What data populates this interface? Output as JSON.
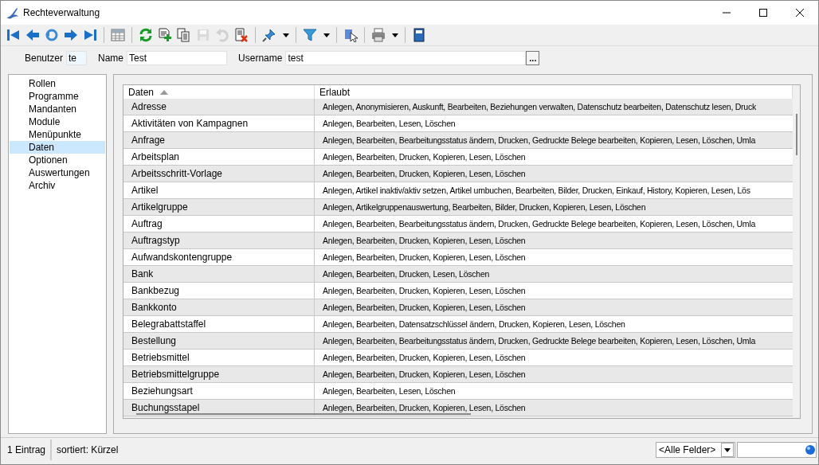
{
  "window": {
    "title": "Rechteverwaltung"
  },
  "toolbar": [
    {
      "kind": "first",
      "disabled": false
    },
    {
      "kind": "prev",
      "disabled": false
    },
    {
      "kind": "back",
      "disabled": false
    },
    {
      "kind": "next",
      "disabled": false
    },
    {
      "kind": "last",
      "disabled": false
    },
    {
      "kind": "sep"
    },
    {
      "kind": "grid",
      "disabled": false
    },
    {
      "kind": "sep"
    },
    {
      "kind": "refresh",
      "disabled": false
    },
    {
      "kind": "new",
      "disabled": false
    },
    {
      "kind": "copy",
      "disabled": false
    },
    {
      "kind": "save",
      "disabled": true
    },
    {
      "kind": "undo",
      "disabled": true
    },
    {
      "kind": "delete",
      "disabled": false
    },
    {
      "kind": "sep"
    },
    {
      "kind": "pin",
      "disabled": false,
      "dropdown": true
    },
    {
      "kind": "sep"
    },
    {
      "kind": "filter",
      "disabled": false,
      "dropdown": true
    },
    {
      "kind": "sep"
    },
    {
      "kind": "pointer",
      "disabled": false
    },
    {
      "kind": "sep"
    },
    {
      "kind": "print",
      "disabled": false,
      "dropdown": true
    },
    {
      "kind": "sep"
    },
    {
      "kind": "book",
      "disabled": false
    }
  ],
  "form": {
    "benutzer_label": "Benutzer",
    "benutzer": "te",
    "name_label": "Name",
    "name": "Test",
    "username_label": "Username",
    "username": "test",
    "browse_button": "..."
  },
  "sidebar": {
    "items": [
      {
        "label": "Rollen",
        "selected": false
      },
      {
        "label": "Programme",
        "selected": false
      },
      {
        "label": "Mandanten",
        "selected": false
      },
      {
        "label": "Module",
        "selected": false
      },
      {
        "label": "Menüpunkte",
        "selected": false
      },
      {
        "label": "Daten",
        "selected": true
      },
      {
        "label": "Optionen",
        "selected": false
      },
      {
        "label": "Auswertungen",
        "selected": false
      },
      {
        "label": "Archiv",
        "selected": false
      }
    ]
  },
  "table": {
    "columns": [
      {
        "label": "Daten",
        "sorted": true
      },
      {
        "label": "Erlaubt",
        "sorted": false
      }
    ],
    "rows": [
      [
        "Adresse",
        "Anlegen, Anonymisieren, Auskunft, Bearbeiten, Beziehungen verwalten, Datenschutz bearbeiten, Datenschutz lesen, Druck"
      ],
      [
        "Aktivitäten von Kampagnen",
        "Anlegen, Bearbeiten, Lesen, Löschen"
      ],
      [
        "Anfrage",
        "Anlegen, Bearbeiten, Bearbeitungsstatus ändern, Drucken, Gedruckte Belege bearbeiten, Kopieren, Lesen, Löschen, Umla"
      ],
      [
        "Arbeitsplan",
        "Anlegen, Bearbeiten, Drucken, Kopieren, Lesen, Löschen"
      ],
      [
        "Arbeitsschritt-Vorlage",
        "Anlegen, Bearbeiten, Drucken, Kopieren, Lesen, Löschen"
      ],
      [
        "Artikel",
        "Anlegen, Artikel inaktiv/aktiv setzen, Artikel umbuchen, Bearbeiten, Bilder, Drucken, Einkauf, History, Kopieren, Lesen, Lös"
      ],
      [
        "Artikelgruppe",
        "Anlegen, Artikelgruppenauswertung, Bearbeiten, Bilder, Drucken, Kopieren, Lesen, Löschen"
      ],
      [
        "Auftrag",
        "Anlegen, Bearbeiten, Bearbeitungsstatus ändern, Drucken, Gedruckte Belege bearbeiten, Kopieren, Lesen, Löschen, Umla"
      ],
      [
        "Auftragstyp",
        "Anlegen, Bearbeiten, Drucken, Kopieren, Lesen, Löschen"
      ],
      [
        "Aufwandskontengruppe",
        "Anlegen, Bearbeiten, Drucken, Kopieren, Lesen, Löschen"
      ],
      [
        "Bank",
        "Anlegen, Bearbeiten, Drucken, Lesen, Löschen"
      ],
      [
        "Bankbezug",
        "Anlegen, Bearbeiten, Drucken, Kopieren, Lesen, Löschen"
      ],
      [
        "Bankkonto",
        "Anlegen, Bearbeiten, Drucken, Kopieren, Lesen, Löschen"
      ],
      [
        "Belegrabattstaffel",
        "Anlegen, Bearbeiten, Datensatzschlüssel ändern, Drucken, Kopieren, Lesen, Löschen"
      ],
      [
        "Bestellung",
        "Anlegen, Bearbeiten, Bearbeitungsstatus ändern, Drucken, Gedruckte Belege bearbeiten, Kopieren, Lesen, Löschen, Umla"
      ],
      [
        "Betriebsmittel",
        "Anlegen, Bearbeiten, Drucken, Kopieren, Lesen, Löschen"
      ],
      [
        "Betriebsmittelgruppe",
        "Anlegen, Bearbeiten, Drucken, Kopieren, Lesen, Löschen"
      ],
      [
        "Beziehungsart",
        "Anlegen, Bearbeiten, Lesen, Löschen"
      ],
      [
        "Buchungsstapel",
        "Anlegen, Bearbeiten, Drucken, Kopieren, Lesen, Löschen"
      ]
    ]
  },
  "status_bar": {
    "count": "1 Eintrag",
    "sort": "sortiert: Kürzel",
    "field_select": "<Alle Felder>"
  }
}
